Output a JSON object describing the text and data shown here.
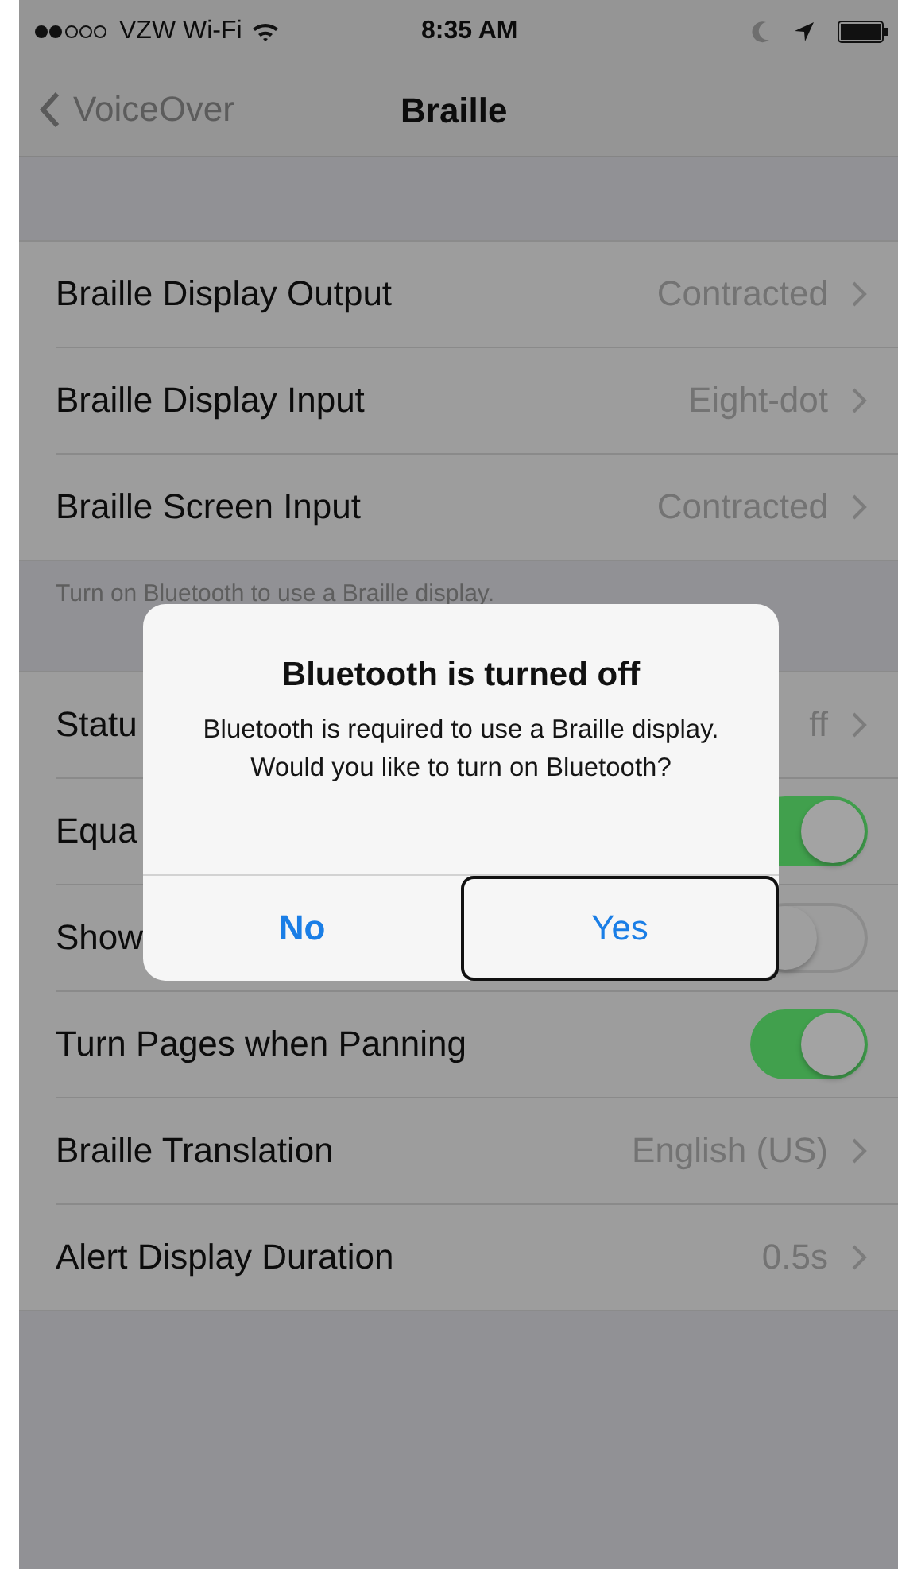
{
  "status_bar": {
    "carrier": "VZW Wi-Fi",
    "time": "8:35 AM"
  },
  "nav": {
    "back": "VoiceOver",
    "title": "Braille"
  },
  "sections": [
    {
      "rows": [
        {
          "kind": "link",
          "label": "Braille Display Output",
          "value": "Contracted"
        },
        {
          "kind": "link",
          "label": "Braille Display Input",
          "value": "Eight-dot"
        },
        {
          "kind": "link",
          "label": "Braille Screen Input",
          "value": "Contracted"
        }
      ],
      "footer": "Turn on Bluetooth to use a Braille display."
    },
    {
      "rows": [
        {
          "kind": "link",
          "label": "Statu",
          "value": "ff"
        },
        {
          "kind": "toggle",
          "label": "Equa",
          "on": true
        },
        {
          "kind": "toggle",
          "label": "Show",
          "on": false
        },
        {
          "kind": "toggle",
          "label": "Turn Pages when Panning",
          "on": true
        },
        {
          "kind": "link",
          "label": "Braille Translation",
          "value": "English (US)"
        },
        {
          "kind": "link",
          "label": "Alert Display Duration",
          "value": "0.5s"
        }
      ]
    }
  ],
  "alert": {
    "title": "Bluetooth is turned off",
    "message": "Bluetooth is required to use a Braille display. Would you like to turn on Bluetooth?",
    "buttons": [
      {
        "kind": "cancel",
        "label": "No",
        "focused": false
      },
      {
        "kind": "default",
        "label": "Yes",
        "focused": true
      }
    ]
  }
}
